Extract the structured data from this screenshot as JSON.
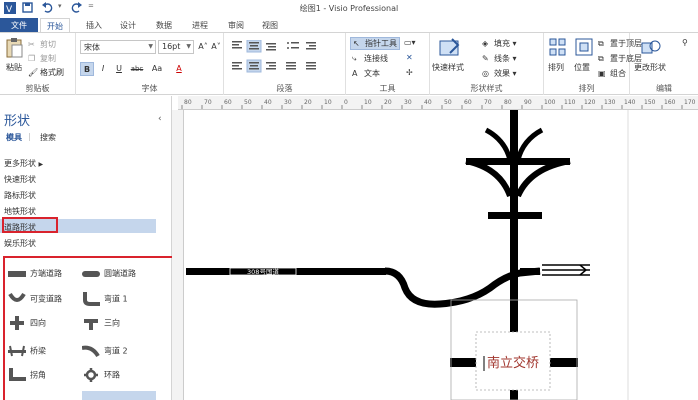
{
  "window": {
    "title": "绘图1 - Visio Professional"
  },
  "tabs": [
    "文件",
    "开始",
    "插入",
    "设计",
    "数据",
    "进程",
    "审阅",
    "视图"
  ],
  "ribbon": {
    "clipboard": {
      "paste": "粘贴",
      "cut": "剪切",
      "copy": "复制",
      "format_painter": "格式刷",
      "label": "剪贴板"
    },
    "font": {
      "name": "宋体",
      "size": "16pt",
      "grow": "A˄",
      "shrink": "A˅",
      "bold": "B",
      "italic": "I",
      "underline": "U",
      "strike": "abc",
      "case": "Aa",
      "color": "A",
      "label": "字体"
    },
    "paragraph": {
      "label": "段落"
    },
    "tools": {
      "pointer": "指针工具",
      "connector": "连接线",
      "text": "文本",
      "label": "工具"
    },
    "shape_styles": {
      "quick_styles": "快速样式",
      "fill": "填充",
      "line": "线条",
      "effects": "效果",
      "label": "形状样式"
    },
    "arrange": {
      "align": "排列",
      "position": "位置",
      "bring_front": "置于顶层",
      "send_back": "置于底层",
      "group": "组合",
      "label": "排列"
    },
    "editing": {
      "change_shape": "更改形状",
      "label": "编辑"
    }
  },
  "panel": {
    "title": "形状",
    "collapse_icon": "‹",
    "subtabs": [
      "模具",
      "搜索"
    ],
    "stencils": [
      "更多形状",
      "快速形状",
      "路标形状",
      "地铁形状",
      "道路形状",
      "娱乐形状"
    ],
    "selected_stencil": "道路形状",
    "shapes": [
      "方端道路",
      "圆端道路",
      "可变道路",
      "弯道 1",
      "四向",
      "三向",
      "桥梁",
      "弯道 2",
      "拐角",
      "环路"
    ]
  },
  "canvas": {
    "road_label": "308号国道",
    "interchange_label": "南立交桥"
  },
  "ruler": {
    "ticks": [
      "80",
      "70",
      "60",
      "50",
      "40",
      "30",
      "20",
      "10",
      "0",
      "10",
      "20",
      "30",
      "40",
      "50",
      "60",
      "70",
      "80",
      "90",
      "100",
      "110",
      "120",
      "130",
      "140",
      "150",
      "160",
      "170"
    ]
  },
  "colors": {
    "accent": "#2b579a",
    "highlight": "#d9232d",
    "selection": "#c5d6ec"
  }
}
